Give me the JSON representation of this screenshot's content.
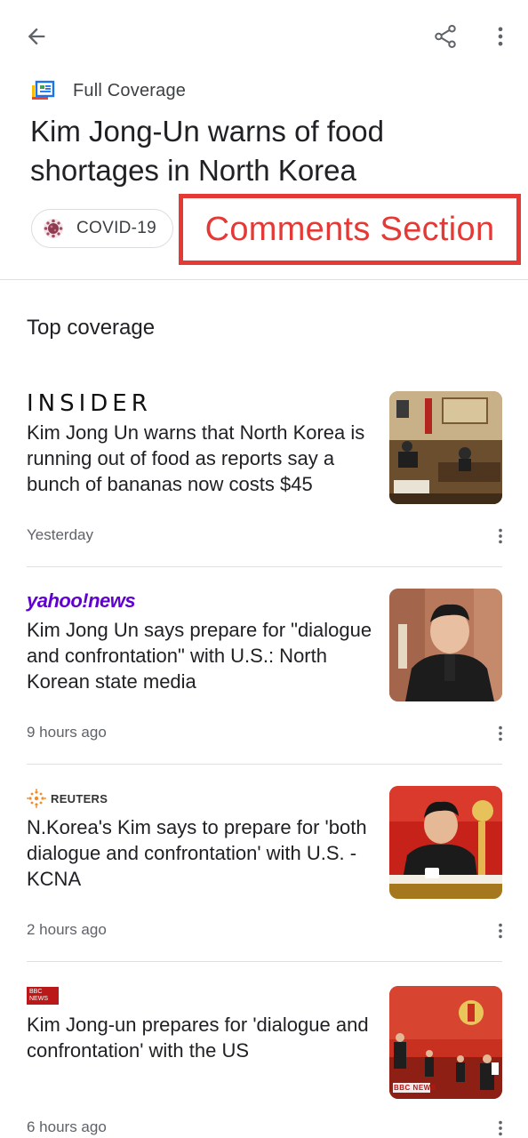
{
  "toolbar": {
    "back_icon": "arrow-left-icon",
    "share_icon": "share-icon",
    "more_icon": "more-vert-icon"
  },
  "full_coverage": {
    "label": "Full Coverage",
    "icon": "full-coverage-icon"
  },
  "headline": "Kim Jong-Un warns of food shortages in North Korea",
  "topic_chip": {
    "label": "COVID-19",
    "icon": "virus-icon"
  },
  "annotation": {
    "text": "Comments Section",
    "color": "#e53935"
  },
  "section": {
    "title": "Top coverage"
  },
  "articles": [
    {
      "source": "INSIDER",
      "title": "Kim Jong Un warns that North Korea is running out of food as reports say a bunch of bananas now costs $45",
      "time": "Yesterday",
      "thumb": "meeting-room-photo"
    },
    {
      "source": "yahoo!news",
      "title": "Kim Jong Un says prepare for \"dialogue and confrontation\" with U.S.: North Korean state media",
      "time": "9 hours ago",
      "thumb": "portrait-photo"
    },
    {
      "source": "REUTERS",
      "title": "N.Korea's Kim says to prepare for 'both dialogue and confrontation' with U.S. -KCNA",
      "time": "2 hours ago",
      "thumb": "speech-photo"
    },
    {
      "source_logo_text": "BBC NEWS",
      "title": "Kim Jong-un prepares for 'dialogue and confrontation' with the US",
      "time": "6 hours ago",
      "thumb": "assembly-photo",
      "thumb_caption": "BBC NEWS"
    }
  ],
  "colors": {
    "accent_red": "#e53935",
    "yahoo_purple": "#6001d2",
    "bbc_red": "#bb1919",
    "text_primary": "#202124",
    "text_secondary": "#5f6368"
  }
}
